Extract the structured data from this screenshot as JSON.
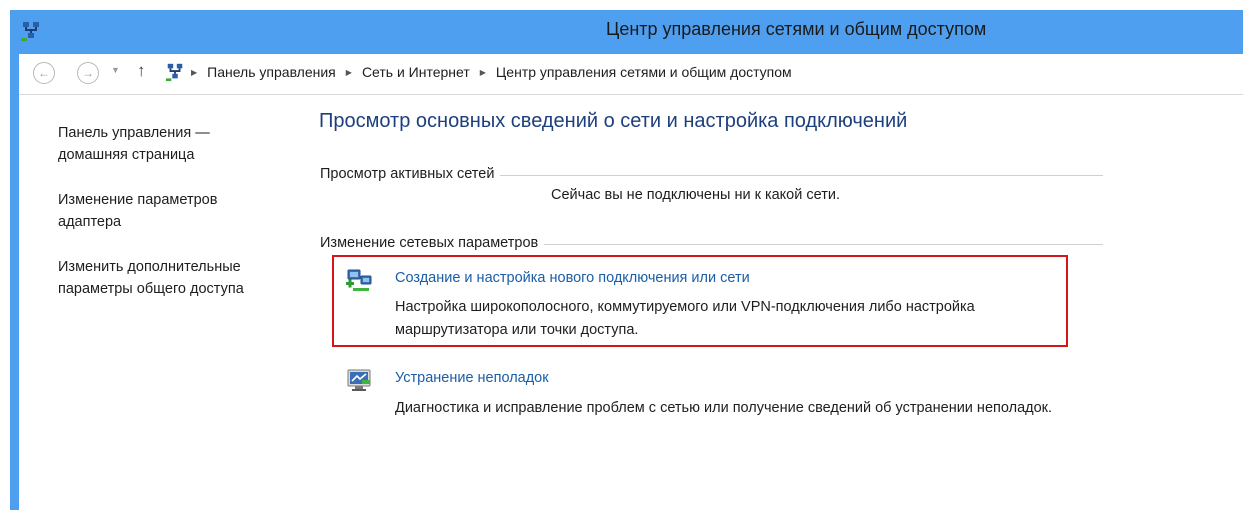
{
  "window": {
    "title": "Центр управления сетями и общим доступом",
    "accent_color": "#4f9ff0"
  },
  "address_bar": {
    "back_icon": "arrow-left-icon",
    "forward_icon": "arrow-right-icon",
    "recent_icon": "chevron-down-icon",
    "up_icon": "arrow-up-icon",
    "location_icon": "network-center-icon",
    "breadcrumbs": [
      "Панель управления",
      "Сеть и Интернет",
      "Центр управления сетями и общим доступом"
    ]
  },
  "sidebar": {
    "items": [
      {
        "label": "Панель управления — домашняя страница"
      },
      {
        "label": "Изменение параметров адаптера"
      },
      {
        "label": "Изменить дополнительные параметры общего доступа"
      }
    ]
  },
  "main": {
    "title": "Просмотр основных сведений о сети и настройка подключений",
    "active_networks": {
      "heading": "Просмотр активных сетей",
      "status": "Сейчас вы не подключены ни к какой сети."
    },
    "change_settings": {
      "heading": "Изменение сетевых параметров",
      "tasks": [
        {
          "icon": "new-connection-icon",
          "link": "Создание и настройка нового подключения или сети",
          "description": "Настройка широкополосного, коммутируемого или VPN-подключения либо настройка маршрутизатора или точки доступа."
        },
        {
          "icon": "troubleshoot-icon",
          "link": "Устранение неполадок",
          "description": "Диагностика и исправление проблем с сетью или получение сведений об устранении неполадок."
        }
      ]
    },
    "highlight_color": "#d4151b"
  }
}
